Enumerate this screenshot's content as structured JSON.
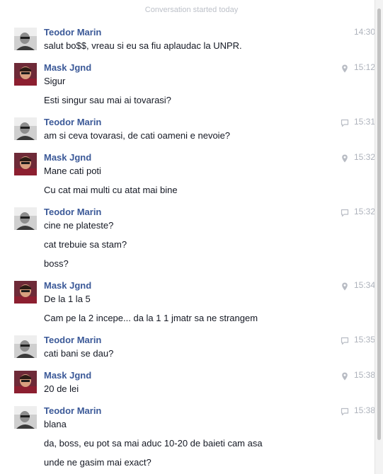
{
  "conversation": {
    "started_label": "Conversation started today"
  },
  "messages": [
    {
      "sender": "Teodor Marin",
      "avatar": "teodor",
      "time": "14:30",
      "status_icon": "",
      "lines": [
        "salut bo$$, vreau si eu sa fiu aplaudac la UNPR."
      ]
    },
    {
      "sender": "Mask Jgnd",
      "avatar": "mask",
      "time": "15:12",
      "status_icon": "location-pin-icon",
      "lines": [
        "Sigur",
        "Esti singur sau mai ai tovarasi?"
      ]
    },
    {
      "sender": "Teodor Marin",
      "avatar": "teodor",
      "time": "15:31",
      "status_icon": "chat-bubble-icon",
      "lines": [
        "am si ceva tovarasi, de cati oameni e nevoie?"
      ]
    },
    {
      "sender": "Mask Jgnd",
      "avatar": "mask",
      "time": "15:32",
      "status_icon": "location-pin-icon",
      "lines": [
        "Mane cati poti",
        "Cu cat mai multi cu atat mai bine"
      ]
    },
    {
      "sender": "Teodor Marin",
      "avatar": "teodor",
      "time": "15:32",
      "status_icon": "chat-bubble-icon",
      "lines": [
        "cine ne plateste?",
        "cat trebuie sa stam?",
        "boss?"
      ]
    },
    {
      "sender": "Mask Jgnd",
      "avatar": "mask",
      "time": "15:34",
      "status_icon": "location-pin-icon",
      "lines": [
        "De la 1 la 5",
        "Cam pe la 2 incepe... da la 1 1 jmatr sa ne strangem"
      ]
    },
    {
      "sender": "Teodor Marin",
      "avatar": "teodor",
      "time": "15:35",
      "status_icon": "chat-bubble-icon",
      "lines": [
        "cati bani se dau?"
      ]
    },
    {
      "sender": "Mask Jgnd",
      "avatar": "mask",
      "time": "15:38",
      "status_icon": "location-pin-icon",
      "lines": [
        "20 de lei"
      ]
    },
    {
      "sender": "Teodor Marin",
      "avatar": "teodor",
      "time": "15:38",
      "status_icon": "chat-bubble-icon",
      "lines": [
        "blana",
        "da, boss, eu pot sa mai aduc 10-20 de baieti cam asa",
        "unde ne gasim mai exact?"
      ]
    }
  ]
}
